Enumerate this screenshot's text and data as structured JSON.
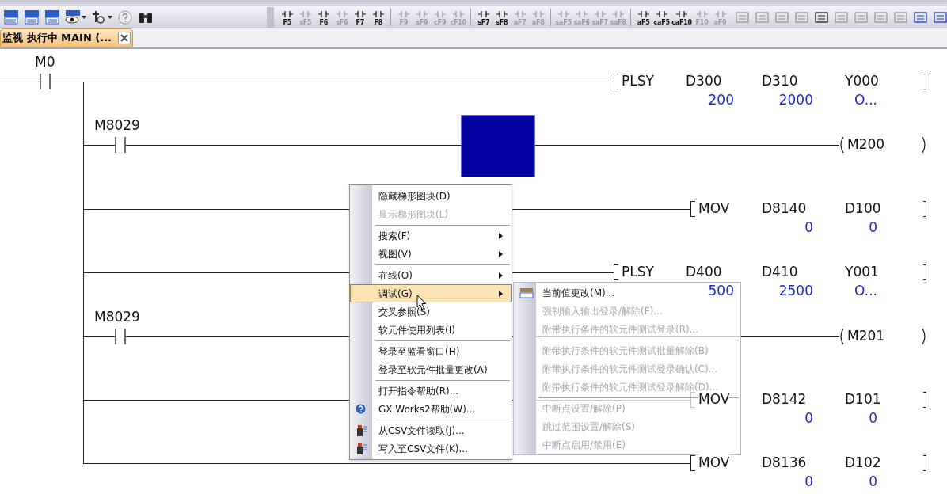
{
  "toolbar": {
    "left_buttons": [
      {
        "kind": "dev"
      },
      {
        "kind": "dev"
      },
      {
        "kind": "dev"
      },
      {
        "kind": "eye"
      },
      {
        "kind": "probe"
      },
      {
        "kind": "help"
      },
      {
        "kind": "binoculars"
      }
    ],
    "key_buttons": [
      {
        "key": "F5",
        "disabled": false
      },
      {
        "key": "sF5",
        "disabled": true
      },
      {
        "key": "F6",
        "disabled": false
      },
      {
        "key": "sF6",
        "disabled": true
      },
      {
        "key": "F7",
        "disabled": false
      },
      {
        "key": "F8",
        "disabled": false
      },
      {
        "key": "F9",
        "disabled": true
      },
      {
        "key": "sF9",
        "disabled": true
      },
      {
        "key": "cF9",
        "disabled": true
      },
      {
        "key": "cF10",
        "disabled": true
      },
      {
        "key": "sF7",
        "disabled": false
      },
      {
        "key": "sF8",
        "disabled": false
      },
      {
        "key": "aF7",
        "disabled": true
      },
      {
        "key": "aF8",
        "disabled": true
      },
      {
        "key": "saF5",
        "disabled": true
      },
      {
        "key": "saF6",
        "disabled": true
      },
      {
        "key": "saF7",
        "disabled": true
      },
      {
        "key": "saF8",
        "disabled": true
      },
      {
        "key": "aF5",
        "disabled": false
      },
      {
        "key": "caF5",
        "disabled": false
      },
      {
        "key": "caF10",
        "disabled": false
      },
      {
        "key": "F10",
        "disabled": true
      },
      {
        "key": "aF9",
        "disabled": true
      }
    ]
  },
  "tab": {
    "title": "监视 执行中 MAIN (...",
    "selected": true
  },
  "rungs": [
    {
      "kind": "instruction",
      "contact": "M0",
      "cursor": false,
      "instruction": "PLSY",
      "operands": [
        {
          "name": "D300",
          "value": "200"
        },
        {
          "name": "D310",
          "value": "2000"
        },
        {
          "name": "Y000",
          "value": "O..."
        }
      ]
    },
    {
      "kind": "coil",
      "contact": "M8029",
      "cursor": true,
      "coil": "M200"
    },
    {
      "kind": "instruction",
      "cursor": false,
      "instruction": "MOV",
      "operands": [
        {
          "name": "D8140",
          "value": "0"
        },
        {
          "name": "D100",
          "value": "0"
        }
      ]
    },
    {
      "kind": "instruction",
      "cursor": false,
      "instruction": "PLSY",
      "operands": [
        {
          "name": "D400",
          "value": "500"
        },
        {
          "name": "D410",
          "value": "2500"
        },
        {
          "name": "Y001",
          "value": "O..."
        }
      ]
    },
    {
      "kind": "coil",
      "contact": "M8029",
      "cursor": false,
      "coil": "M201"
    },
    {
      "kind": "instruction",
      "cursor": false,
      "instruction": "MOV",
      "operands": [
        {
          "name": "D8142",
          "value": "0"
        },
        {
          "name": "D101",
          "value": "0"
        }
      ]
    },
    {
      "kind": "instruction",
      "cursor": false,
      "instruction": "MOV",
      "operands": [
        {
          "name": "D8136",
          "value": "0"
        },
        {
          "name": "D102",
          "value": "0"
        }
      ]
    }
  ],
  "context_menu": [
    {
      "kind": "item",
      "label": "隐藏梯形图块(D)",
      "disabled": false,
      "submenu": false,
      "selected": false
    },
    {
      "kind": "item",
      "label": "显示梯形图块(L)",
      "disabled": true,
      "submenu": false,
      "selected": false
    },
    {
      "kind": "separator"
    },
    {
      "kind": "item",
      "label": "搜索(F)",
      "disabled": false,
      "submenu": true,
      "selected": false
    },
    {
      "kind": "item",
      "label": "视图(V)",
      "disabled": false,
      "submenu": true,
      "selected": false
    },
    {
      "kind": "separator"
    },
    {
      "kind": "item",
      "label": "在线(O)",
      "disabled": false,
      "submenu": true,
      "selected": false
    },
    {
      "kind": "item",
      "label": "调试(G)",
      "disabled": false,
      "submenu": true,
      "selected": true
    },
    {
      "kind": "item",
      "label": "交叉参照(S)",
      "disabled": false,
      "submenu": false,
      "selected": false
    },
    {
      "kind": "item",
      "label": "软元件使用列表(I)",
      "disabled": false,
      "submenu": false,
      "selected": false
    },
    {
      "kind": "separator"
    },
    {
      "kind": "item",
      "label": "登录至监看窗口(H)",
      "disabled": false,
      "submenu": false,
      "selected": false
    },
    {
      "kind": "item",
      "label": "登录至软元件批量更改(A)",
      "disabled": false,
      "submenu": false,
      "selected": false
    },
    {
      "kind": "separator"
    },
    {
      "kind": "item",
      "label": "打开指令帮助(R)...",
      "disabled": false,
      "submenu": false,
      "selected": false
    },
    {
      "kind": "help",
      "label": "GX Works2帮助(W)...",
      "disabled": false,
      "submenu": false,
      "selected": false
    },
    {
      "kind": "separator"
    },
    {
      "kind": "csv",
      "label": "从CSV文件读取(J)...",
      "disabled": false,
      "submenu": false,
      "selected": false
    },
    {
      "kind": "csv",
      "label": "写入至CSV文件(K)...",
      "disabled": false,
      "submenu": false,
      "selected": false
    }
  ],
  "debug_submenu": [
    {
      "kind": "dev",
      "label": "当前值更改(M)...",
      "disabled": false
    },
    {
      "kind": "item",
      "label": "强制输入输出登录/解除(F)...",
      "disabled": true
    },
    {
      "kind": "item",
      "label": "附带执行条件的软元件测试登录(R)...",
      "disabled": true
    },
    {
      "kind": "separator"
    },
    {
      "kind": "item",
      "label": "附带执行条件的软元件测试批量解除(B)",
      "disabled": true
    },
    {
      "kind": "item",
      "label": "附带执行条件的软元件测试登录确认(C)...",
      "disabled": true
    },
    {
      "kind": "item",
      "label": "附带执行条件的软元件测试登录解除(D)...",
      "disabled": true
    },
    {
      "kind": "separator"
    },
    {
      "kind": "item",
      "label": "中断点设置/解除(P)",
      "disabled": true
    },
    {
      "kind": "item",
      "label": "跳过范围设置/解除(S)",
      "disabled": true
    },
    {
      "kind": "item",
      "label": "中断点启用/禁用(E)",
      "disabled": true
    }
  ]
}
